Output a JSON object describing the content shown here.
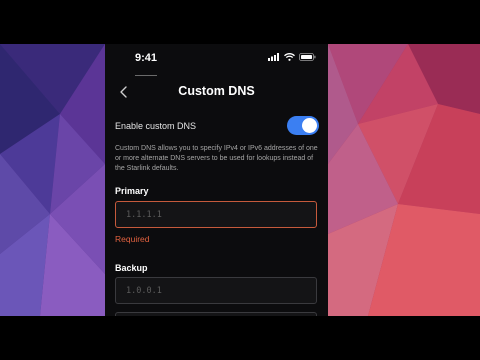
{
  "colors": {
    "accent": "#3b7ff2",
    "error": "#e0613f",
    "background": "#0c0c0e"
  },
  "status_bar": {
    "time": "9:41",
    "icons": [
      "signal-icon",
      "wifi-icon",
      "battery-icon"
    ]
  },
  "header": {
    "title": "Custom DNS",
    "back_icon": "chevron-left-icon"
  },
  "toggle": {
    "label": "Enable custom DNS",
    "enabled": true
  },
  "description": "Custom DNS allows you to specify IPv4 or IPv6 addresses of one or more alternate DNS servers to be used for lookups instead of the Starlink defaults.",
  "primary": {
    "label": "Primary",
    "placeholder": "1.1.1.1",
    "value": "",
    "error": "Required"
  },
  "backup": {
    "label": "Backup",
    "placeholder": "1.0.0.1",
    "value": ""
  }
}
